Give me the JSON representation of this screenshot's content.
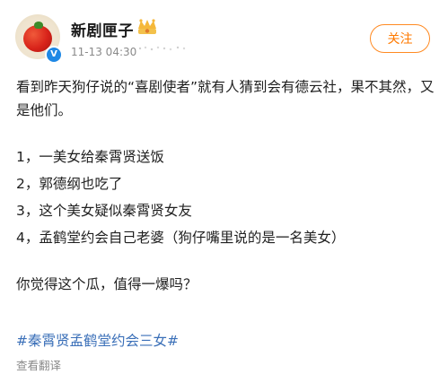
{
  "header": {
    "username": "新剧匣子",
    "meta": "11-13 04:30",
    "follow_label": "关注"
  },
  "icons": {
    "avatar": "tomato-avatar",
    "verified": "blue-v-badge",
    "member": "crown-icon"
  },
  "post": {
    "intro": "看到昨天狗仔说的“喜剧使者”就有人猜到会有德云社，果不其然，又是他们。",
    "items": [
      "1，一美女给秦霄贤送饭",
      "2，郭德纲也吃了",
      "3，这个美女疑似秦霄贤女友",
      "4，孟鹤堂约会自己老婆（狗仔嘴里说的是一名美女）"
    ],
    "question": "你觉得这个瓜，值得一爆吗？",
    "hashtag": "#秦霄贤孟鹤堂约会三女#",
    "translate_label": "查看翻译"
  },
  "colors": {
    "follow": "#ff7a00",
    "hashtag": "#3a6fb8",
    "verified": "#1e88e5"
  }
}
